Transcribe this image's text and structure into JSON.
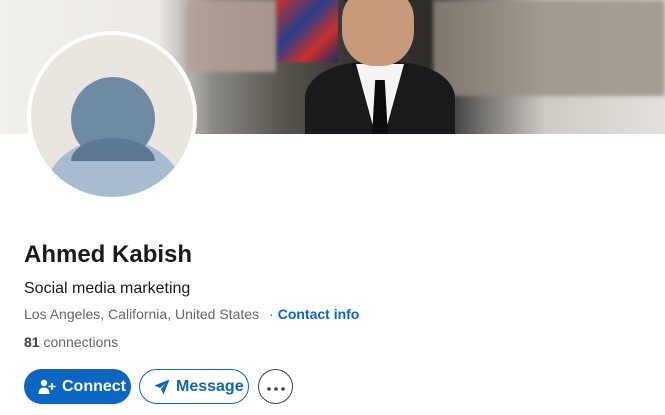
{
  "profile": {
    "name": "Ahmed Kabish",
    "headline": "Social media marketing",
    "location": "Los Angeles, California, United States",
    "separator": "·",
    "contact_info": "Contact info",
    "connections_count": "81",
    "connections_label": "connections"
  },
  "actions": {
    "connect_label": "Connect",
    "message_label": "Message",
    "more_icon": "ellipsis-icon",
    "connect_icon": "add-person-icon",
    "message_icon": "paper-plane-icon"
  },
  "colors": {
    "brand_blue": "#0a66c2",
    "text_primary": "#1a1a1a",
    "text_secondary": "#666666"
  }
}
